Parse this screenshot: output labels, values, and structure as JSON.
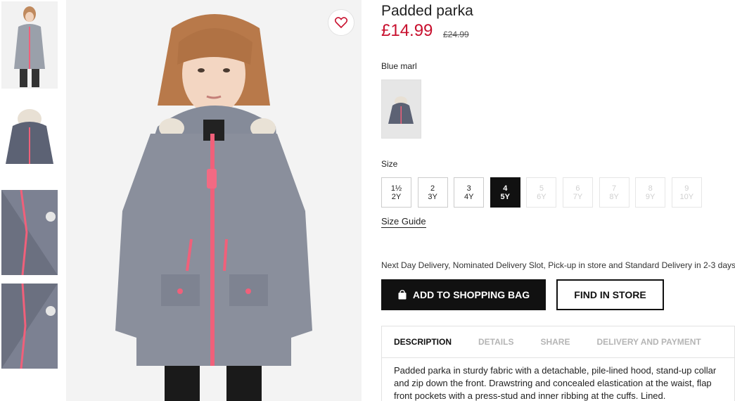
{
  "product": {
    "title": "Padded parka",
    "price": "£14.99",
    "old_price": "£24.99",
    "color_name": "Blue marl",
    "size_label": "Size",
    "size_guide": "Size Guide",
    "delivery_note": "Next Day Delivery, Nominated Delivery Slot, Pick-up in store and Standard Delivery in 2-3 days.",
    "add_to_bag": "ADD TO SHOPPING BAG",
    "find_in_store": "FIND IN STORE"
  },
  "sizes": [
    {
      "line1": "1½",
      "line2": "2Y",
      "state": "available"
    },
    {
      "line1": "2",
      "line2": "3Y",
      "state": "available"
    },
    {
      "line1": "3",
      "line2": "4Y",
      "state": "available"
    },
    {
      "line1": "4",
      "line2": "5Y",
      "state": "selected"
    },
    {
      "line1": "5",
      "line2": "6Y",
      "state": "disabled"
    },
    {
      "line1": "6",
      "line2": "7Y",
      "state": "disabled"
    },
    {
      "line1": "7",
      "line2": "8Y",
      "state": "disabled"
    },
    {
      "line1": "8",
      "line2": "9Y",
      "state": "disabled"
    },
    {
      "line1": "9",
      "line2": "10Y",
      "state": "disabled"
    }
  ],
  "tabs": [
    {
      "label": "DESCRIPTION",
      "active": true
    },
    {
      "label": "DETAILS",
      "active": false
    },
    {
      "label": "SHARE",
      "active": false
    },
    {
      "label": "DELIVERY AND PAYMENT",
      "active": false
    }
  ],
  "description": "Padded parka in sturdy fabric with a detachable, pile-lined hood, stand-up collar and zip down the front. Drawstring and concealed elastication at the waist, flap front pockets with a press-stud and inner ribbing at the cuffs. Lined.",
  "icons": {
    "favorite": "heart-icon",
    "bag": "shopping-bag-icon"
  },
  "colors": {
    "price_red": "#c8102e",
    "jacket_grey": "#8a8f9c",
    "zip_pink": "#f0607a"
  }
}
